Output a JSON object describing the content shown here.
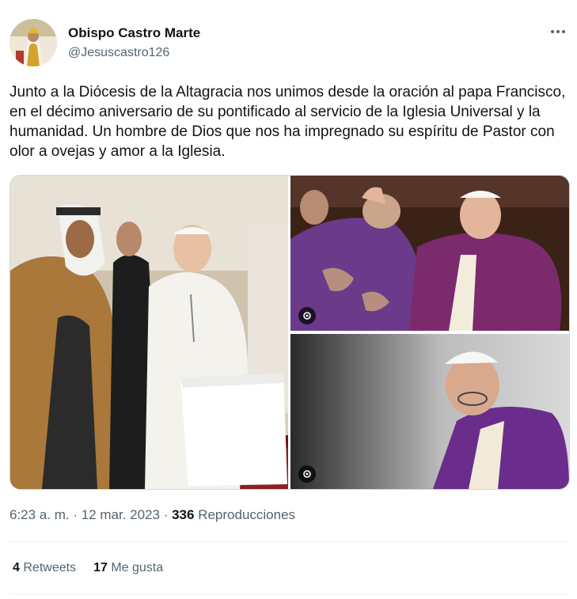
{
  "author": {
    "display_name": "Obispo Castro Marte",
    "handle": "@Jesuscastro126"
  },
  "tweet": {
    "text": "Junto a la Diócesis de la Altagracia nos unimos desde la oración  al papa Francisco, en el décimo aniversario de su pontificado al servicio de la Iglesia Universal y la humanidad. Un hombre de Dios que nos ha impregnado su espíritu de Pastor con olor a ovejas y amor a la Iglesia."
  },
  "meta": {
    "time": "6:23 a. m.",
    "sep1": " · ",
    "date": "12 mar. 2023",
    "sep2": " · ",
    "views_count": "336",
    "views_label": "Reproducciones"
  },
  "stats": {
    "retweets_count": "4",
    "retweets_label": "Retweets",
    "likes_count": "17",
    "likes_label": "Me gusta"
  },
  "icons": {
    "more": "more-horizontal-icon",
    "alt": "alt-text-icon"
  }
}
